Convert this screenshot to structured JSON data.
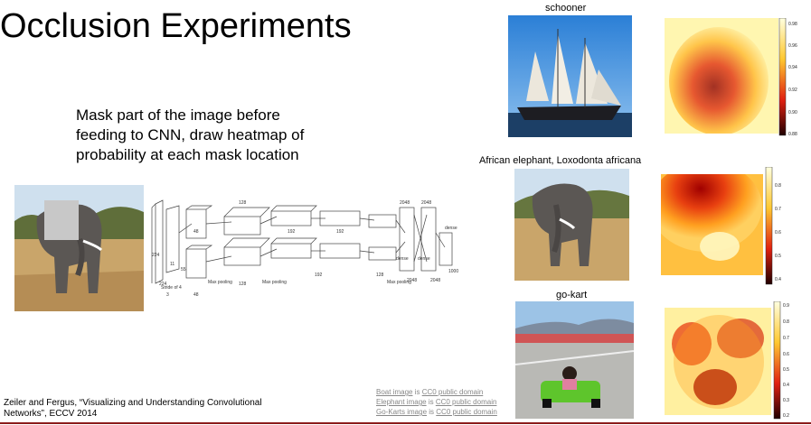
{
  "slide": {
    "title": "Occlusion Experiments",
    "bullet_lines": [
      "Mask part of the image before",
      "feeding to CNN, draw heatmap of",
      "probability at each mask location"
    ],
    "citation_line1": "Zeiler and Fergus, “Visualizing and Understanding Convolutional",
    "citation_line2": "Networks”, ECCV 2014"
  },
  "credits": [
    {
      "link": "Boat image",
      "mid": " is ",
      "license": "CC0 public domain"
    },
    {
      "link": "Elephant image",
      "mid": " is ",
      "license": "CC0 public domain"
    },
    {
      "link": "Go-Karts image",
      "mid": " is ",
      "license": "CC0 public domain"
    }
  ],
  "examples": [
    {
      "label": "schooner",
      "colorbar_ticks": [
        "0.98",
        "0.96",
        "0.94",
        "0.92",
        "0.90",
        "0.88"
      ]
    },
    {
      "label": "African elephant, Loxodonta africana",
      "colorbar_ticks": [
        "0.8",
        "0.7",
        "0.6",
        "0.5",
        "0.4"
      ]
    },
    {
      "label": "go-kart",
      "colorbar_ticks": [
        "0.9",
        "0.8",
        "0.7",
        "0.6",
        "0.5",
        "0.4",
        "0.3",
        "0.2"
      ]
    }
  ],
  "diagram": {
    "sizes": [
      "224",
      "224",
      "11",
      "11",
      "55",
      "3",
      "48",
      "128",
      "192",
      "192",
      "128",
      "2048",
      "2048",
      "13",
      "13",
      "27",
      "27",
      "5",
      "5",
      "3",
      "3",
      "1000"
    ],
    "labels": [
      "Stride of 4",
      "Max pooling",
      "Max pooling",
      "Max pooling",
      "dense",
      "dense",
      "dense"
    ]
  },
  "colors": {
    "accent": "#8b1a1a",
    "credit_gray": "#888888",
    "heat_high": "#8b0000",
    "heat_low": "#fffbe0"
  }
}
